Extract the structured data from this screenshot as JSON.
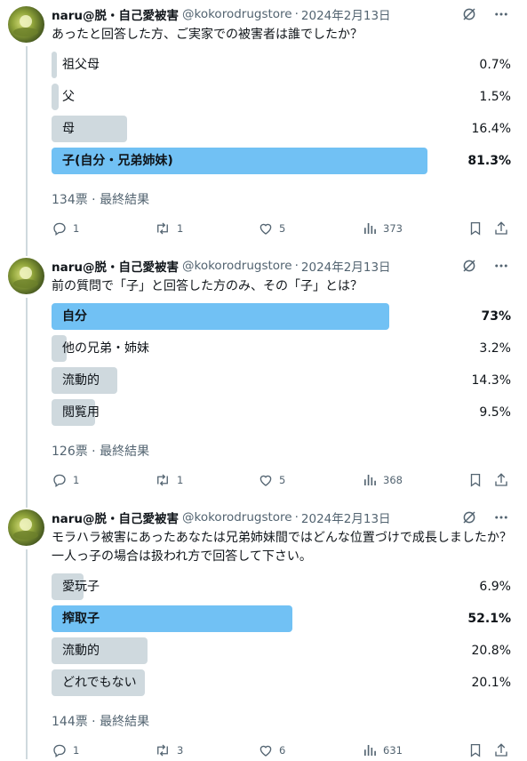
{
  "author": {
    "name": "naru@脱・自己愛被害",
    "handle": "@kokorodrugstore",
    "separator": "·"
  },
  "icons": {
    "grok": "grok-icon",
    "more": "more-icon",
    "reply": "reply-icon",
    "retweet": "retweet-icon",
    "like": "like-icon",
    "views": "views-icon",
    "bookmark": "bookmark-icon",
    "share": "share-icon"
  },
  "colors": {
    "winner_bar": "#71c1f4",
    "other_bar": "#cfd9de",
    "secondary_text": "#536471"
  },
  "tweets": [
    {
      "date": "2024年2月13日",
      "text": "あったと回答した方、ご実家での被害者は誰でしたか？",
      "poll": [
        {
          "label": "祖父母",
          "pct": "0.7%",
          "fraction": 0.007,
          "winner": false
        },
        {
          "label": "父",
          "pct": "1.5%",
          "fraction": 0.015,
          "winner": false
        },
        {
          "label": "母",
          "pct": "16.4%",
          "fraction": 0.164,
          "winner": false
        },
        {
          "label": "子(自分・兄弟姉妹)",
          "pct": "81.3%",
          "fraction": 0.813,
          "winner": true
        }
      ],
      "result": "134票 · 最終結果",
      "replies": "1",
      "retweets": "1",
      "likes": "5",
      "views": "373"
    },
    {
      "date": "2024年2月13日",
      "text": "前の質問で「子」と回答した方のみ、その「子」とは？",
      "poll": [
        {
          "label": "自分",
          "pct": "73%",
          "fraction": 0.73,
          "winner": true
        },
        {
          "label": "他の兄弟・姉妹",
          "pct": "3.2%",
          "fraction": 0.032,
          "winner": false
        },
        {
          "label": "流動的",
          "pct": "14.3%",
          "fraction": 0.143,
          "winner": false
        },
        {
          "label": "閲覧用",
          "pct": "9.5%",
          "fraction": 0.095,
          "winner": false
        }
      ],
      "result": "126票 · 最終結果",
      "replies": "1",
      "retweets": "1",
      "likes": "5",
      "views": "368"
    },
    {
      "date": "2024年2月13日",
      "text": "モラハラ被害にあったあなたは兄弟姉妹間ではどんな位置づけで成長しましたか？一人っ子の場合は扱われ方で回答して下さい。",
      "poll": [
        {
          "label": "愛玩子",
          "pct": "6.9%",
          "fraction": 0.069,
          "winner": false
        },
        {
          "label": "搾取子",
          "pct": "52.1%",
          "fraction": 0.521,
          "winner": true
        },
        {
          "label": "流動的",
          "pct": "20.8%",
          "fraction": 0.208,
          "winner": false
        },
        {
          "label": "どれでもない",
          "pct": "20.1%",
          "fraction": 0.201,
          "winner": false
        }
      ],
      "result": "144票 · 最終結果",
      "replies": "1",
      "retweets": "3",
      "likes": "6",
      "views": "631"
    }
  ]
}
